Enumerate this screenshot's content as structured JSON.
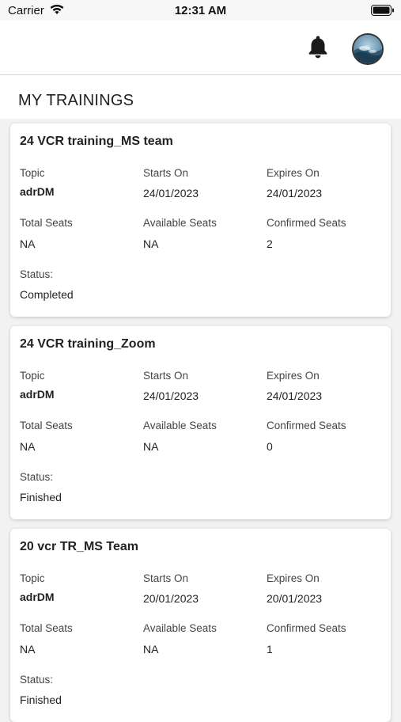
{
  "status_bar": {
    "carrier": "Carrier",
    "time": "12:31 AM"
  },
  "header": {
    "bell_icon": "bell-icon",
    "avatar": "profile-avatar"
  },
  "page": {
    "title": "MY TRAININGS"
  },
  "labels": {
    "topic": "Topic",
    "starts_on": "Starts On",
    "expires_on": "Expires On",
    "total_seats": "Total Seats",
    "available_seats": "Available Seats",
    "confirmed_seats": "Confirmed Seats",
    "status": "Status:"
  },
  "trainings": [
    {
      "title": "24 VCR training_MS team",
      "topic": "adrDM",
      "starts_on": "24/01/2023",
      "expires_on": "24/01/2023",
      "total_seats": "NA",
      "available_seats": "NA",
      "confirmed_seats": "2",
      "status": "Completed"
    },
    {
      "title": "24 VCR training_Zoom",
      "topic": "adrDM",
      "starts_on": "24/01/2023",
      "expires_on": "24/01/2023",
      "total_seats": "NA",
      "available_seats": "NA",
      "confirmed_seats": "0",
      "status": "Finished"
    },
    {
      "title": "20 vcr TR_MS Team",
      "topic": "adrDM",
      "starts_on": "20/01/2023",
      "expires_on": "20/01/2023",
      "total_seats": "NA",
      "available_seats": "NA",
      "confirmed_seats": "1",
      "status": "Finished"
    }
  ]
}
